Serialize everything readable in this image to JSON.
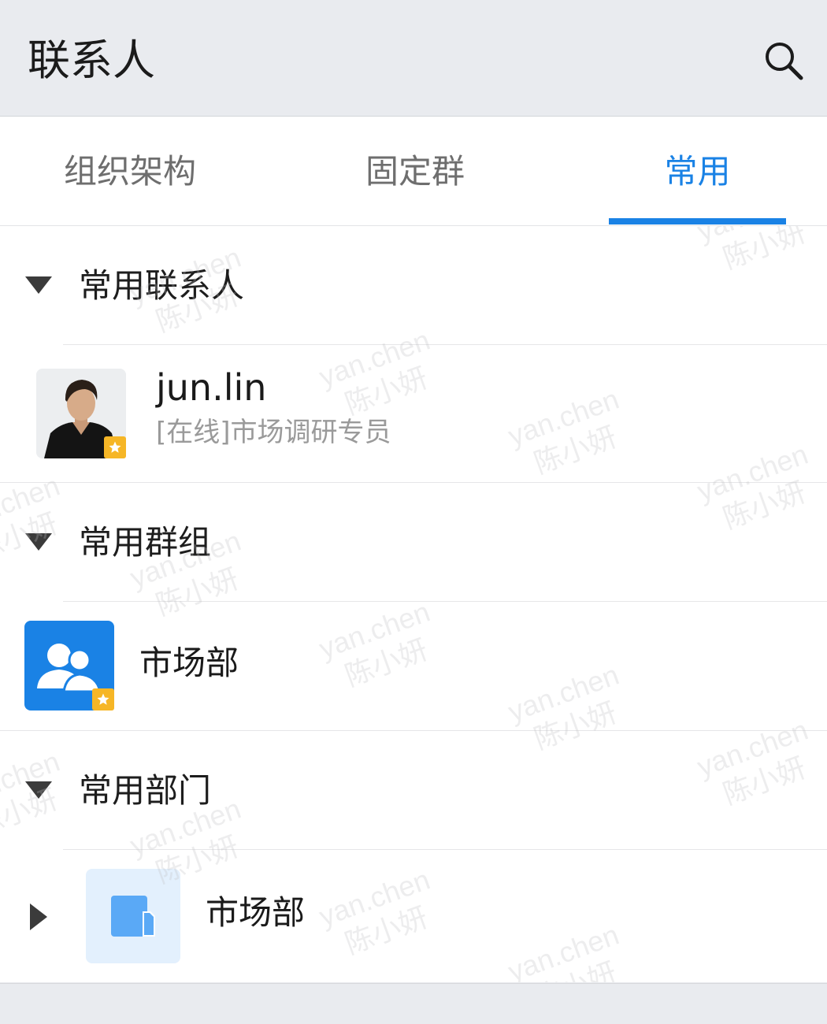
{
  "header": {
    "title": "联系人",
    "search_icon": "search-icon"
  },
  "tabs": [
    {
      "label": "组织架构",
      "active": false
    },
    {
      "label": "固定群",
      "active": false
    },
    {
      "label": "常用",
      "active": true
    }
  ],
  "colors": {
    "accent": "#1a82e5",
    "star_badge": "#f6b626",
    "group_avatar": "#1a82e5",
    "dept_avatar_bg": "#e3f0fd",
    "dept_icon": "#5aa9f6"
  },
  "sections": {
    "contacts": {
      "label": "常用联系人",
      "items": [
        {
          "name": "jun.lin",
          "subtitle": "[在线]市场调研专员",
          "avatar": "user-photo",
          "favorite": true
        }
      ]
    },
    "groups": {
      "label": "常用群组",
      "items": [
        {
          "name": "市场部",
          "avatar": "group-icon",
          "favorite": true
        }
      ]
    },
    "departments": {
      "label": "常用部门",
      "items": [
        {
          "name": "市场部",
          "avatar": "department-icon",
          "expandable": true
        }
      ]
    }
  },
  "watermark": {
    "line1": "yan.chen",
    "line2": "陈小妍"
  }
}
